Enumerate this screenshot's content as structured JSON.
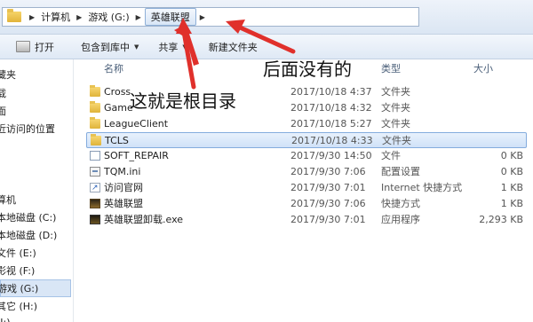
{
  "address": {
    "crumbs": [
      "计算机",
      "游戏 (G:)",
      "英雄联盟"
    ]
  },
  "toolbar": {
    "open": "打开",
    "include_in_library": "包含到库中",
    "share": "共享",
    "new_folder": "新建文件夹"
  },
  "sidebar": {
    "items": [
      "藏夹",
      "载",
      "面",
      "近访问的位置",
      "算机",
      "本地磁盘 (C:)",
      "本地磁盘 (D:)",
      "文件 (E:)",
      "影视 (F:)",
      "游戏 (G:)",
      "其它 (H:)",
      "(I:)"
    ]
  },
  "columns": {
    "name": "名称",
    "type": "类型",
    "size": "大小"
  },
  "files": [
    {
      "name": "Cross",
      "date": "2017/10/18 4:37",
      "type": "文件夹",
      "size": "",
      "icon": "folder-icon"
    },
    {
      "name": "Game",
      "date": "2017/10/18 4:32",
      "type": "文件夹",
      "size": "",
      "icon": "folder-icon"
    },
    {
      "name": "LeagueClient",
      "date": "2017/10/18 5:27",
      "type": "文件夹",
      "size": "",
      "icon": "folder-icon"
    },
    {
      "name": "TCLS",
      "date": "2017/10/18 4:33",
      "type": "文件夹",
      "size": "",
      "icon": "folder-icon"
    },
    {
      "name": "SOFT_REPAIR",
      "date": "2017/9/30 14:50",
      "type": "文件",
      "size": "0 KB",
      "icon": "file-icon"
    },
    {
      "name": "TQM.ini",
      "date": "2017/9/30 7:06",
      "type": "配置设置",
      "size": "0 KB",
      "icon": "ini-file-icon"
    },
    {
      "name": "访问官网",
      "date": "2017/9/30 7:01",
      "type": "Internet 快捷方式",
      "size": "1 KB",
      "icon": "internet-shortcut-icon"
    },
    {
      "name": "英雄联盟",
      "date": "2017/9/30 7:06",
      "type": "快捷方式",
      "size": "1 KB",
      "icon": "game-shortcut-icon"
    },
    {
      "name": "英雄联盟卸载.exe",
      "date": "2017/9/30 7:01",
      "type": "应用程序",
      "size": "2,293 KB",
      "icon": "exe-icon"
    }
  ],
  "annotations": {
    "root_dir": "这就是根目录",
    "nothing_after": "后面没有的"
  }
}
